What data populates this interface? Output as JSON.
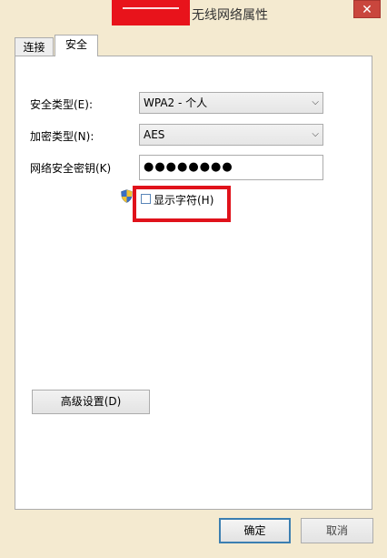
{
  "window": {
    "title": "无线网络属性",
    "close_glyph": "✕"
  },
  "tabs": [
    {
      "label": "连接"
    },
    {
      "label": "安全"
    }
  ],
  "security": {
    "type_label": "安全类型(E):",
    "type_value": "WPA2 - 个人",
    "encryption_label": "加密类型(N):",
    "encryption_value": "AES",
    "key_label": "网络安全密钥(K)",
    "key_value": "●●●●●●●●",
    "show_chars_label": "显示字符(H)",
    "show_chars_checked": false
  },
  "buttons": {
    "advanced": "高级设置(D)",
    "ok": "确定",
    "cancel": "取消"
  },
  "colors": {
    "window_frame": "#f4ead0",
    "highlight_red": "#e0121b",
    "close_red": "#c9463d",
    "ok_border": "#3c7fb1"
  },
  "icons": {
    "shield": "uac-shield-icon",
    "dropdown": "chevron-down-icon",
    "close": "close-icon"
  }
}
